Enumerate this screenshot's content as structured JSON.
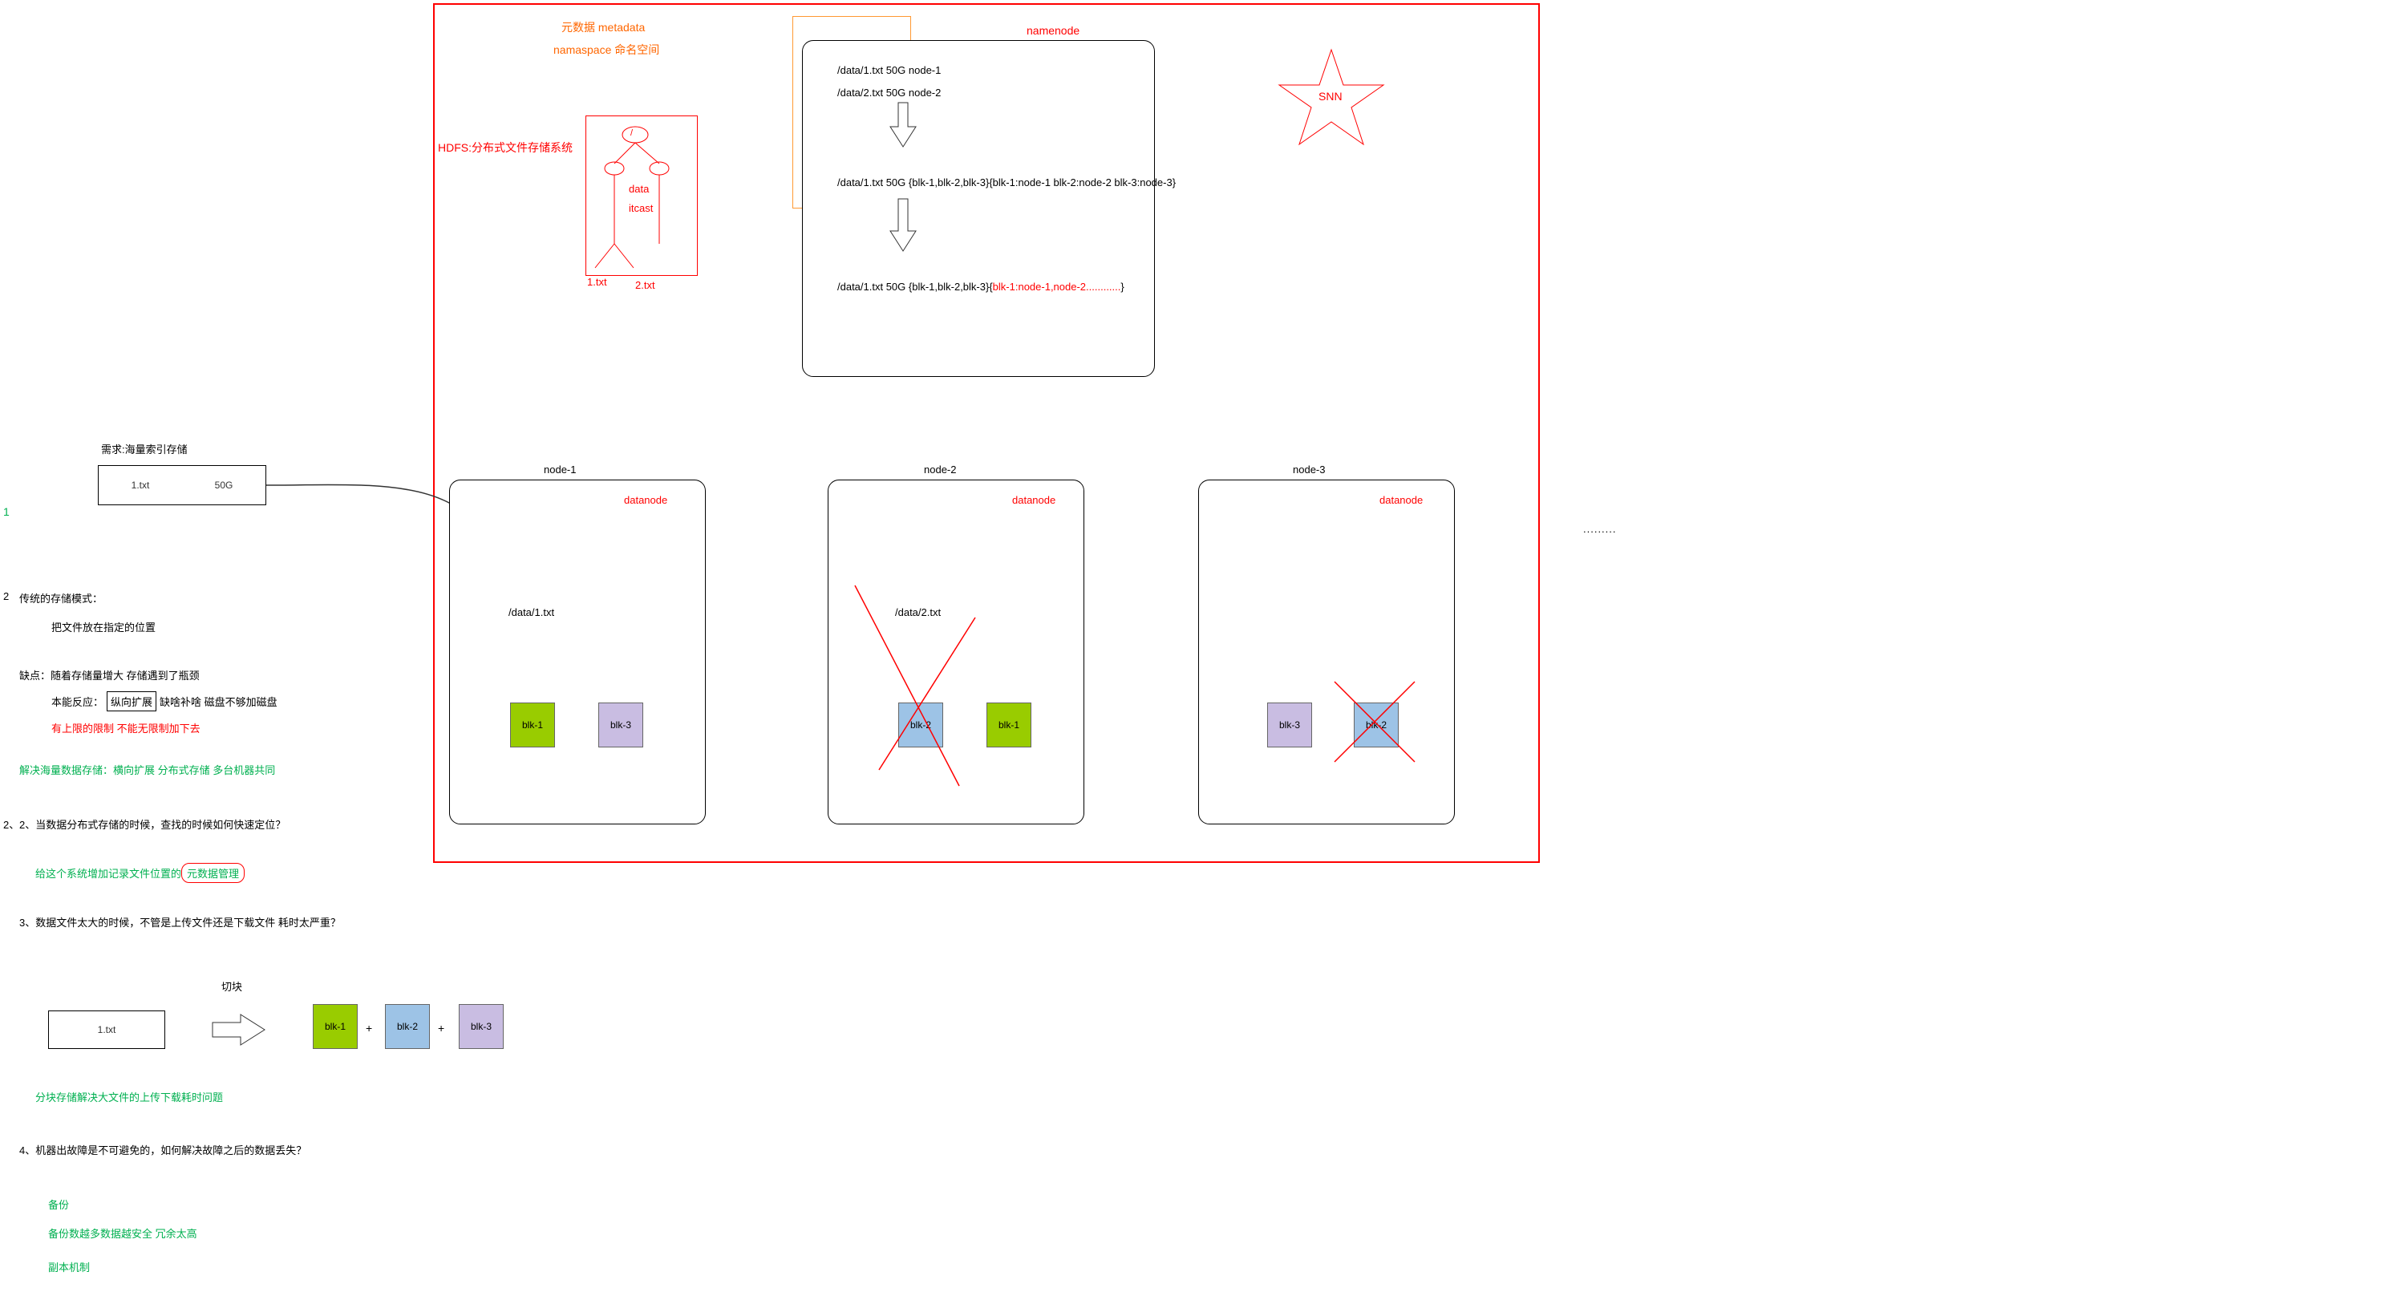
{
  "main_border": {},
  "metadata_labels": {
    "line1": "元数据  metadata",
    "line2": "namaspace 命名空间"
  },
  "hdfs_label": "HDFS:分布式文件存储系统",
  "tree": {
    "root": "( / )",
    "data": "data",
    "itcast": "itcast",
    "f1": "1.txt",
    "f2": "2.txt"
  },
  "namenode": {
    "title": "namenode",
    "row1a": "/data/1.txt   50G   node-1",
    "row1b": "/data/2.txt   50G   node-2",
    "row2": "/data/1.txt   50G   {blk-1,blk-2,blk-3}{blk-1:node-1   blk-2:node-2    blk-3:node-3}",
    "row3_prefix": "/data/1.txt  50G {blk-1,blk-2,blk-3}{",
    "row3_red": "blk-1:node-1,node-2............",
    "row3_suffix": "}"
  },
  "snn": "SNN",
  "need": "需求:海量索引存储",
  "filebox": {
    "name": "1.txt",
    "size": "50G"
  },
  "nodes": {
    "n1": {
      "title": "node-1",
      "role": "datanode",
      "file": "/data/1.txt",
      "b1": "blk-1",
      "b2": "blk-3"
    },
    "n2": {
      "title": "node-2",
      "role": "datanode",
      "file": "/data/2.txt",
      "b1": "blk-2",
      "b2": "blk-1"
    },
    "n3": {
      "title": "node-3",
      "role": "datanode",
      "b1": "blk-3",
      "b2": "blk-2"
    }
  },
  "ellipsis": ".........",
  "left_notes": {
    "q1_a": "传统的存储模式：",
    "q1_b": "把文件放在指定的位置",
    "q1_c": "缺点：随着存储量增大  存储遇到了瓶颈",
    "q1_d_pre": "本能反应：",
    "q1_d_box": "纵向扩展",
    "q1_d_post": "  缺啥补啥  磁盘不够加磁盘",
    "q1_e": "有上限的限制  不能无限制加下去",
    "q1_f": "解决海量数据存储：横向扩展   分布式存储  多台机器共同",
    "q2": "2、当数据分布式存储的时候，查找的时候如何快速定位？",
    "q2_ans_pre": "给这个系统增加记录文件位置的",
    "q2_ans_circ": "元数据管理",
    "q3": "3、数据文件太大的时候，不管是上传文件还是下载文件  耗时太严重？",
    "q3_cut": "切块",
    "q3_file": "1.txt",
    "q3_b1": "blk-1",
    "q3_b2": "blk-2",
    "q3_b3": "blk-3",
    "q3_plus": "+",
    "q3_ans": "分块存储解决大文件的上传下载耗时问题",
    "q4": "4、机器出故障是不可避免的，如何解决故障之后的数据丢失？",
    "q4_a": "备份",
    "q4_b": "备份数越多数据越安全   冗余太高",
    "q4_c": "副本机制"
  }
}
